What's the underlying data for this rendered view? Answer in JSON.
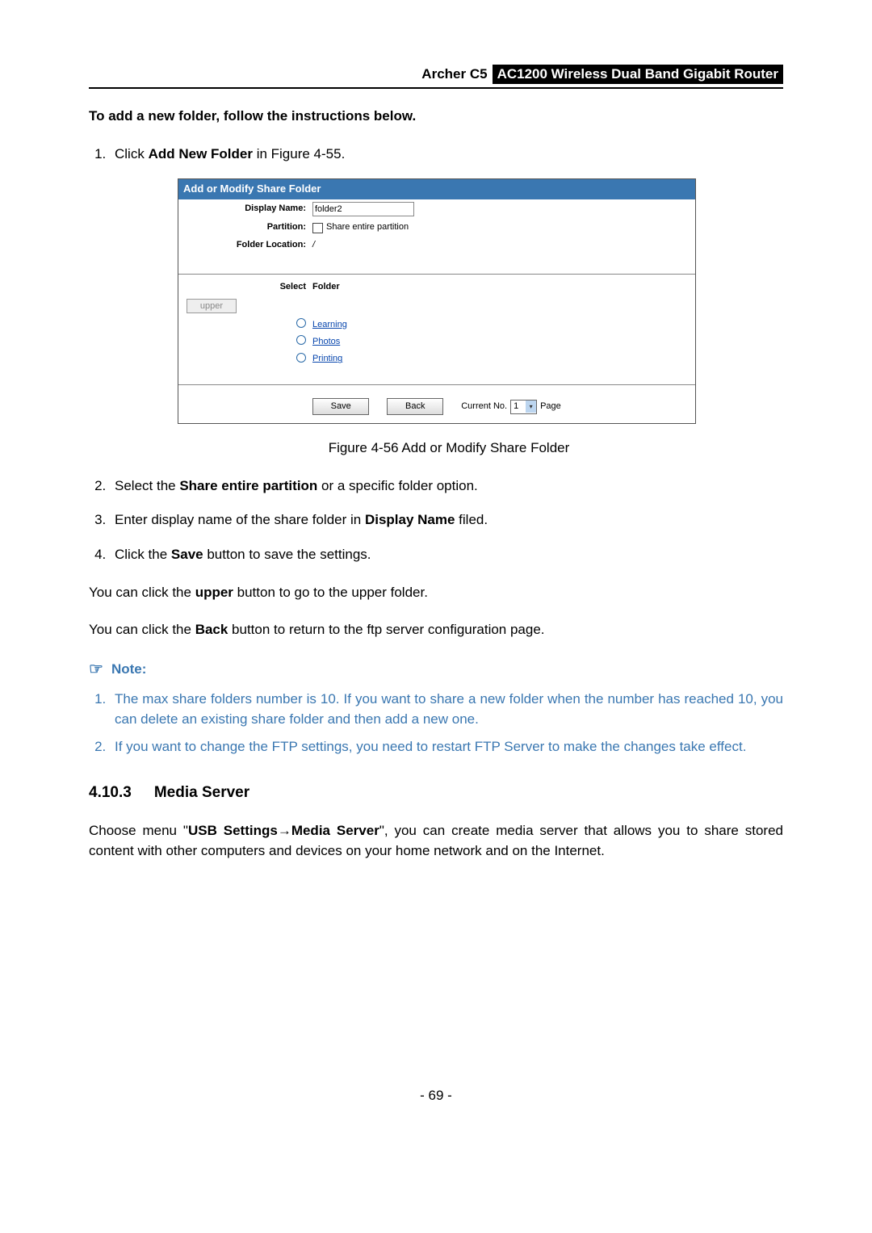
{
  "header": {
    "product": "Archer C5",
    "model": "AC1200 Wireless Dual Band Gigabit Router"
  },
  "intro_bold": "To add a new folder, follow the instructions below.",
  "step1_pre": "Click ",
  "step1_bold": "Add New Folder",
  "step1_post": " in Figure 4-55.",
  "figure": {
    "title": "Add or Modify Share Folder",
    "display_name_label": "Display Name:",
    "display_name_value": "folder2",
    "partition_label": "Partition:",
    "partition_text": "Share entire partition",
    "folder_location_label": "Folder Location:",
    "folder_location_value": "/",
    "select_hdr": "Select",
    "folder_hdr": "Folder",
    "upper_btn": "upper",
    "rows": [
      "Learning",
      "Photos",
      "Printing"
    ],
    "save": "Save",
    "back": "Back",
    "current_no_label": "Current No.",
    "current_no_value": "1",
    "page_label": "Page"
  },
  "figure_caption": "Figure 4-56 Add or Modify Share Folder",
  "step2_pre": "Select the ",
  "step2_bold": "Share entire partition",
  "step2_post": " or a specific folder option.",
  "step3_pre": "Enter display name of the share folder in ",
  "step3_bold": "Display Name",
  "step3_post": " filed.",
  "step4_pre": "Click the ",
  "step4_bold": "Save",
  "step4_post": " button to save the settings.",
  "upper_line_pre": "You can click the ",
  "upper_line_bold": "upper",
  "upper_line_post": " button to go to the upper folder.",
  "back_line_pre": "You can click the ",
  "back_line_bold": "Back",
  "back_line_post": " button to return to the ftp server configuration page.",
  "note_label": "Note:",
  "note1": "The max share folders number is 10. If you want to share a new folder when the number has reached 10, you can delete an existing share folder and then add a new one.",
  "note2": "If you want to change the FTP settings, you need to restart FTP Server to make the changes take effect.",
  "section_num": "4.10.3",
  "section_title": "Media Server",
  "media_p_pre": "Choose menu \"",
  "media_p_bold1": "USB Settings",
  "media_p_arrow": "→",
  "media_p_bold2": "Media Server",
  "media_p_post": "\", you can create media server that allows you to share stored content with other computers and devices on your home network and on the Internet.",
  "page_number": "- 69 -"
}
